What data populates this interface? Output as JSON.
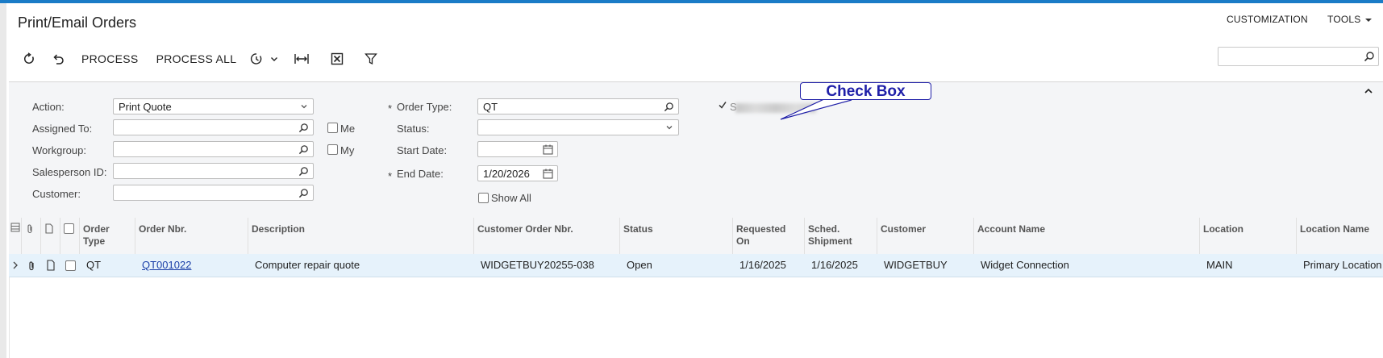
{
  "header": {
    "title": "Print/Email Orders",
    "menu": {
      "customization": "CUSTOMIZATION",
      "tools": "TOOLS"
    }
  },
  "toolbar": {
    "refresh_icon": "refresh-icon",
    "undo_icon": "undo-icon",
    "process_label": "PROCESS",
    "process_all_label": "PROCESS ALL",
    "schedule_icon": "clock-icon",
    "fit_icon": "fit-to-screen-icon",
    "excel_icon": "excel-export-icon",
    "filter_icon": "filter-icon"
  },
  "search": {
    "value": "",
    "placeholder": ""
  },
  "filter": {
    "action": {
      "label": "Action:",
      "value": "Print Quote"
    },
    "assigned_to": {
      "label": "Assigned To:",
      "value": ""
    },
    "workgroup": {
      "label": "Workgroup:",
      "value": ""
    },
    "salesperson": {
      "label": "Salesperson ID:",
      "value": ""
    },
    "customer": {
      "label": "Customer:",
      "value": ""
    },
    "me_label": "Me",
    "my_label": "My",
    "order_type": {
      "label": "Order Type:",
      "value": "QT"
    },
    "status": {
      "label": "Status:",
      "value": ""
    },
    "start_date": {
      "label": "Start Date:",
      "value": ""
    },
    "end_date": {
      "label": "End Date:",
      "value": "1/20/2026"
    },
    "show_all_label": "Show All",
    "required_mark": "*",
    "blurred_checkbox_letter": "S",
    "callout_label": "Check Box"
  },
  "grid": {
    "columns": {
      "order_type": "Order Type",
      "order_nbr": "Order Nbr.",
      "description": "Description",
      "customer_order_nbr": "Customer Order Nbr.",
      "status": "Status",
      "requested_on": "Requested On",
      "sched_shipment": "Sched. Shipment",
      "customer": "Customer",
      "account_name": "Account Name",
      "location": "Location",
      "location_name": "Location Name"
    },
    "rows": [
      {
        "order_type": "QT",
        "order_nbr": "QT001022",
        "description": "Computer repair quote",
        "customer_order_nbr": "WIDGETBUY20255-038",
        "status": "Open",
        "requested_on": "1/16/2025",
        "sched_shipment": "1/16/2025",
        "customer": "WIDGETBUY",
        "account_name": "Widget Connection",
        "location": "MAIN",
        "location_name": "Primary Location"
      }
    ]
  },
  "colors": {
    "accent": "#1a7cc7",
    "row_selected": "#e6f2fb",
    "link": "#1a3fa8",
    "callout": "#1f1fa8"
  }
}
